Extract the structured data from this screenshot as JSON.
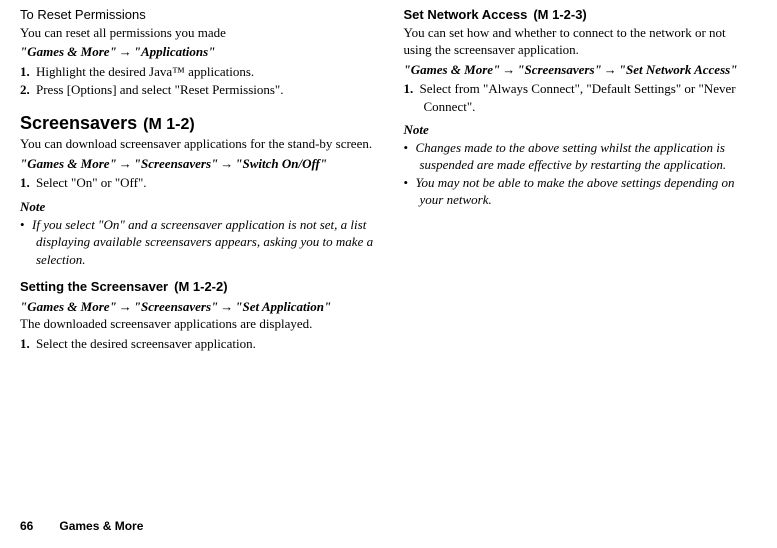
{
  "left": {
    "reset": {
      "title": "To Reset Permissions",
      "desc": "You can reset all permissions you made",
      "path_seg1": "\"Games & More\"",
      "path_seg2": "\"Applications\"",
      "steps": [
        "Highlight the desired Java™ applications.",
        "Press [Options] and select \"Reset Permissions\"."
      ]
    },
    "screensavers": {
      "title": "Screensavers",
      "code": "(M 1-2)",
      "desc": "You can download screensaver applications for the stand-by screen.",
      "path_seg1": "\"Games & More\"",
      "path_seg2": "\"Screensavers\"",
      "path_seg3": "\"Switch On/Off\"",
      "steps": [
        "Select \"On\" or \"Off\"."
      ],
      "note_heading": "Note",
      "notes": [
        "If you select \"On\" and a screensaver application is not set, a list displaying available screensavers appears, asking you to make a selection."
      ]
    },
    "setting": {
      "title": "Setting the Screensaver",
      "code": "(M 1-2-2)",
      "path_seg1": "\"Games & More\"",
      "path_seg2": "\"Screensavers\"",
      "path_seg3": "\"Set Application\"",
      "desc": "The downloaded screensaver applications are displayed.",
      "steps": [
        "Select the desired screensaver application."
      ]
    }
  },
  "right": {
    "network": {
      "title": "Set Network Access",
      "code": "(M 1-2-3)",
      "desc": "You can set how and whether to connect to the network or not using the screensaver application.",
      "path_seg1": "\"Games & More\"",
      "path_seg2": "\"Screensavers\"",
      "path_seg3": "\"Set Network Access\"",
      "steps": [
        "Select from \"Always Connect\", \"Default Settings\" or \"Never Connect\"."
      ],
      "note_heading": "Note",
      "notes": [
        "Changes made to the above setting whilst the application is suspended are made effective by restarting the application.",
        "You may not be able to make the above settings depending on your network."
      ]
    }
  },
  "footer": {
    "page": "66",
    "section": "Games & More"
  },
  "arrow": "→"
}
